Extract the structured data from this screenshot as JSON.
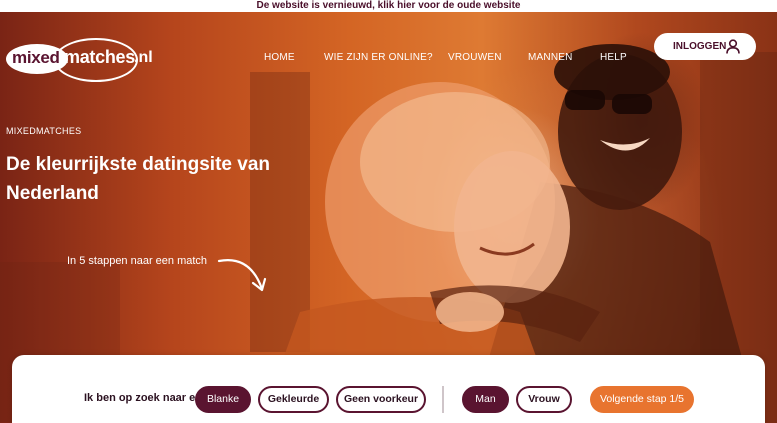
{
  "banner": {
    "text": "De website is vernieuwd, klik hier voor de oude website"
  },
  "logo": {
    "part1": "mixed",
    "part2": "matches",
    "part3": ".nl"
  },
  "nav": {
    "items": [
      {
        "label": "HOME"
      },
      {
        "label": "WIE ZIJN ER ONLINE?"
      },
      {
        "label": "VROUWEN"
      },
      {
        "label": "MANNEN"
      },
      {
        "label": "HELP"
      }
    ],
    "login_label": "INLOGGEN"
  },
  "hero": {
    "eyebrow": "MIXEDMATCHES",
    "headline": "De kleurrijkste datingsite van Nederland",
    "steps_text": "In 5 stappen naar een match",
    "image_description_icon": "couple-photo"
  },
  "search": {
    "label": "Ik ben op zoek naar een",
    "ethnicity_options": [
      {
        "label": "Blanke",
        "selected": true
      },
      {
        "label": "Gekleurde",
        "selected": false
      },
      {
        "label": "Geen voorkeur",
        "selected": false
      }
    ],
    "gender_options": [
      {
        "label": "Man",
        "selected": true
      },
      {
        "label": "Vrouw",
        "selected": false
      }
    ],
    "next_label": "Volgende stap 1/5"
  },
  "colors": {
    "brand_dark": "#5a1430",
    "accent_orange": "#e8742f",
    "hero_overlay": "#d46524"
  }
}
